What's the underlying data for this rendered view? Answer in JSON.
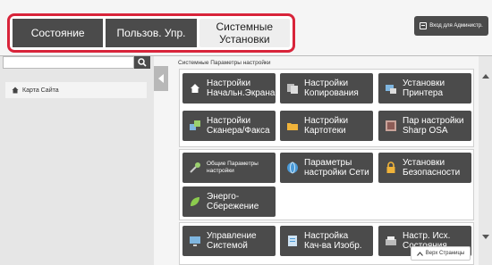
{
  "tabs": [
    {
      "label": "Состояние"
    },
    {
      "label": "Пользов. Упр."
    },
    {
      "label": "Системные\nУстановки"
    }
  ],
  "header": {
    "admin_login": "Вход для Администр."
  },
  "sidebar": {
    "search_placeholder": "",
    "items": [
      {
        "label": "Карта Сайта"
      }
    ]
  },
  "main": {
    "section_title": "Системные Параметры настройки",
    "buttons": {
      "home": "Настройки\nНачальн.Экрана",
      "copy": "Настройки\nКопирования",
      "printer": "Установки\nПринтера",
      "scanfax": "Настройки\nСканера/Факса",
      "docfiling": "Настройки\nКартотеки",
      "osa": "Пар настройки\nSharp OSA",
      "common": "Общие Параметры\nнастройки",
      "network": "Параметры\nнастройки Сети",
      "security": "Установки\nБезопасности",
      "energy": "Энерго-\nСбережение",
      "sysctl": "Управление\nСистемой",
      "quality": "Настройка\nКач-ва Изобр.",
      "defaults": "Настр. Исх.\nСостояния"
    }
  },
  "footer": {
    "top_page": "Верх Страницы"
  },
  "colors": {
    "accent_red": "#d8243a",
    "tab_dark": "#4b4b4b",
    "tab_active": "#eeeeee"
  }
}
